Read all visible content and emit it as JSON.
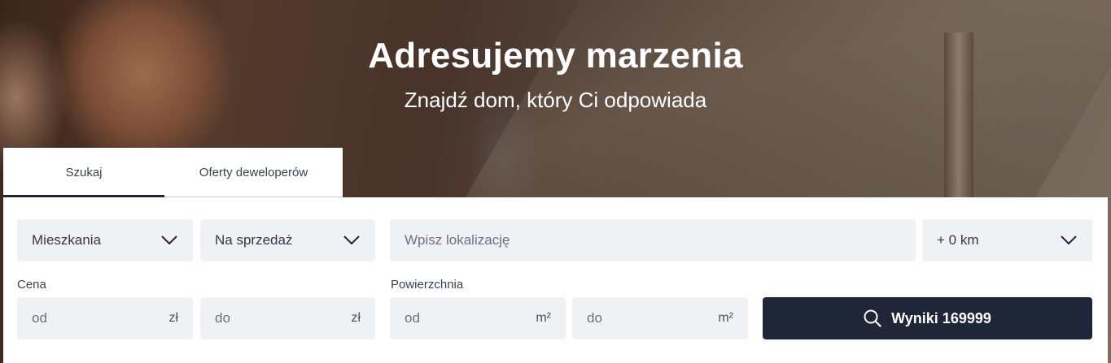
{
  "hero": {
    "title": "Adresujemy marzenia",
    "subtitle": "Znajdź dom, który Ci odpowiada"
  },
  "tabs": [
    {
      "label": "Szukaj",
      "active": true
    },
    {
      "label": "Oferty deweloperów",
      "active": false
    }
  ],
  "search": {
    "property_type": "Mieszkania",
    "transaction_type": "Na sprzedaż",
    "location_placeholder": "Wpisz lokalizację",
    "radius": "+ 0 km",
    "price_label": "Cena",
    "price_from_placeholder": "od",
    "price_to_placeholder": "do",
    "price_unit": "zł",
    "area_label": "Powierzchnia",
    "area_from_placeholder": "od",
    "area_to_placeholder": "do",
    "area_unit": "m²",
    "results_button": "Wyniki 169999",
    "search_icon": "search-icon",
    "chevron_icon": "chevron-down-icon"
  },
  "colors": {
    "accent": "#1e2638",
    "field_bg": "#f0f1f5"
  }
}
